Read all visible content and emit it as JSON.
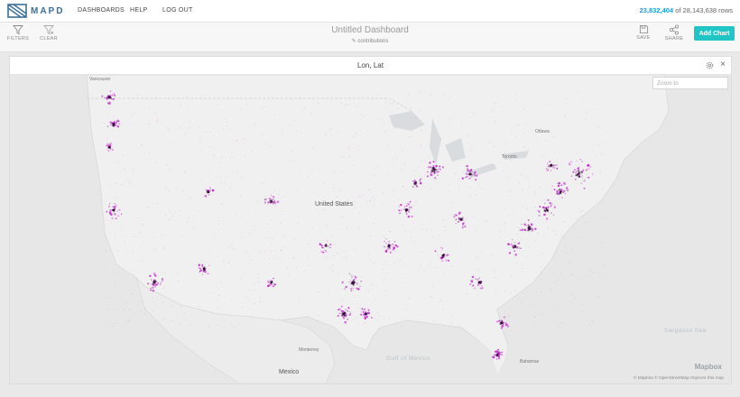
{
  "app": {
    "name": "MAPD"
  },
  "nav": {
    "dashboards": "DASHBOARDS",
    "help": "HELP",
    "logout": "LOG OUT"
  },
  "rows": {
    "filtered": "23,832,404",
    "of_text": "of 28,143,638 rows"
  },
  "toolbar": {
    "filters": "FILTERS",
    "clear": "CLEAR",
    "dashboard_title": "Untitled Dashboard",
    "dashboard_subtitle": "contributions",
    "save": "SAVE",
    "share": "SHARE",
    "add_chart": "Add Chart"
  },
  "chart": {
    "title": "Lon, Lat",
    "zoom_placeholder": "Zoom to",
    "mapbox": "Mapbox",
    "attribution": "© Mapbox  © OpenStreetMap  Improve this map"
  },
  "map_labels": {
    "country_us": "United States",
    "country_mx": "Mexico",
    "gulf": "Gulf of Mexico",
    "sargasso": "Sargasso Sea",
    "ottawa": "Ottawa",
    "toronto": "Toronto",
    "vancouver": "Vancouver",
    "monterrey": "Monterrey",
    "bahamas": "Bahamas"
  },
  "colors": {
    "accent": "#22c5c5",
    "rows_highlight": "#1a9fd8",
    "point": "#c01ec8",
    "point_dense": "#3a0a40"
  }
}
